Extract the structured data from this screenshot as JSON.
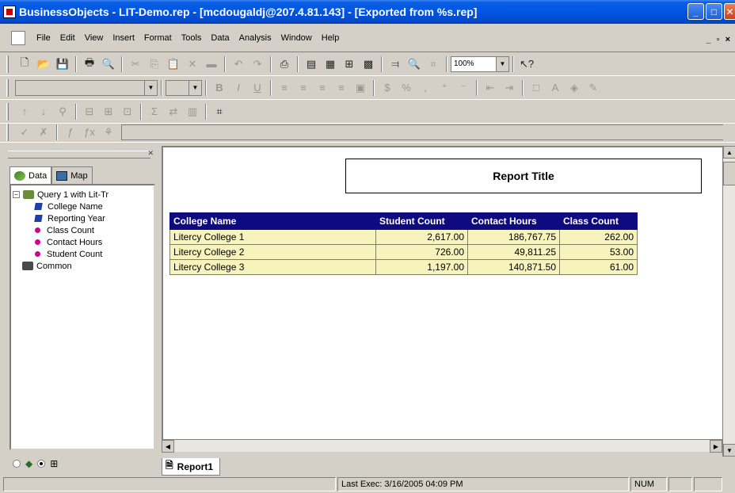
{
  "window": {
    "title": "BusinessObjects - LIT-Demo.rep - [mcdougaldj@207.4.81.143] - [Exported from %s.rep]"
  },
  "menu": [
    "File",
    "Edit",
    "View",
    "Insert",
    "Format",
    "Tools",
    "Data",
    "Analysis",
    "Window",
    "Help"
  ],
  "toolbar": {
    "zoom_value": "100%"
  },
  "left_panel": {
    "tabs": [
      "Data",
      "Map"
    ],
    "tree": {
      "root": "Query 1 with Lit-Tr",
      "children": [
        "College Name",
        "Reporting Year",
        "Class Count",
        "Contact Hours",
        "Student Count"
      ],
      "sibling": "Common"
    }
  },
  "report": {
    "title": "Report Title",
    "columns": [
      "College Name",
      "Student Count",
      "Contact Hours",
      "Class Count"
    ],
    "rows": [
      [
        "Litercy College 1",
        "2,617.00",
        "186,767.75",
        "262.00"
      ],
      [
        "Litercy College 2",
        "726.00",
        "49,811.25",
        "53.00"
      ],
      [
        "Litercy College 3",
        "1,197.00",
        "140,871.50",
        "61.00"
      ]
    ],
    "sheet_tab": "Report1"
  },
  "status": {
    "last_exec": "Last Exec: 3/16/2005  04:09 PM",
    "num": "NUM"
  },
  "colors": {
    "header_bg": "#0e0a80",
    "cell_bg": "#f7f3bd",
    "titlebar": "#0055e5"
  }
}
